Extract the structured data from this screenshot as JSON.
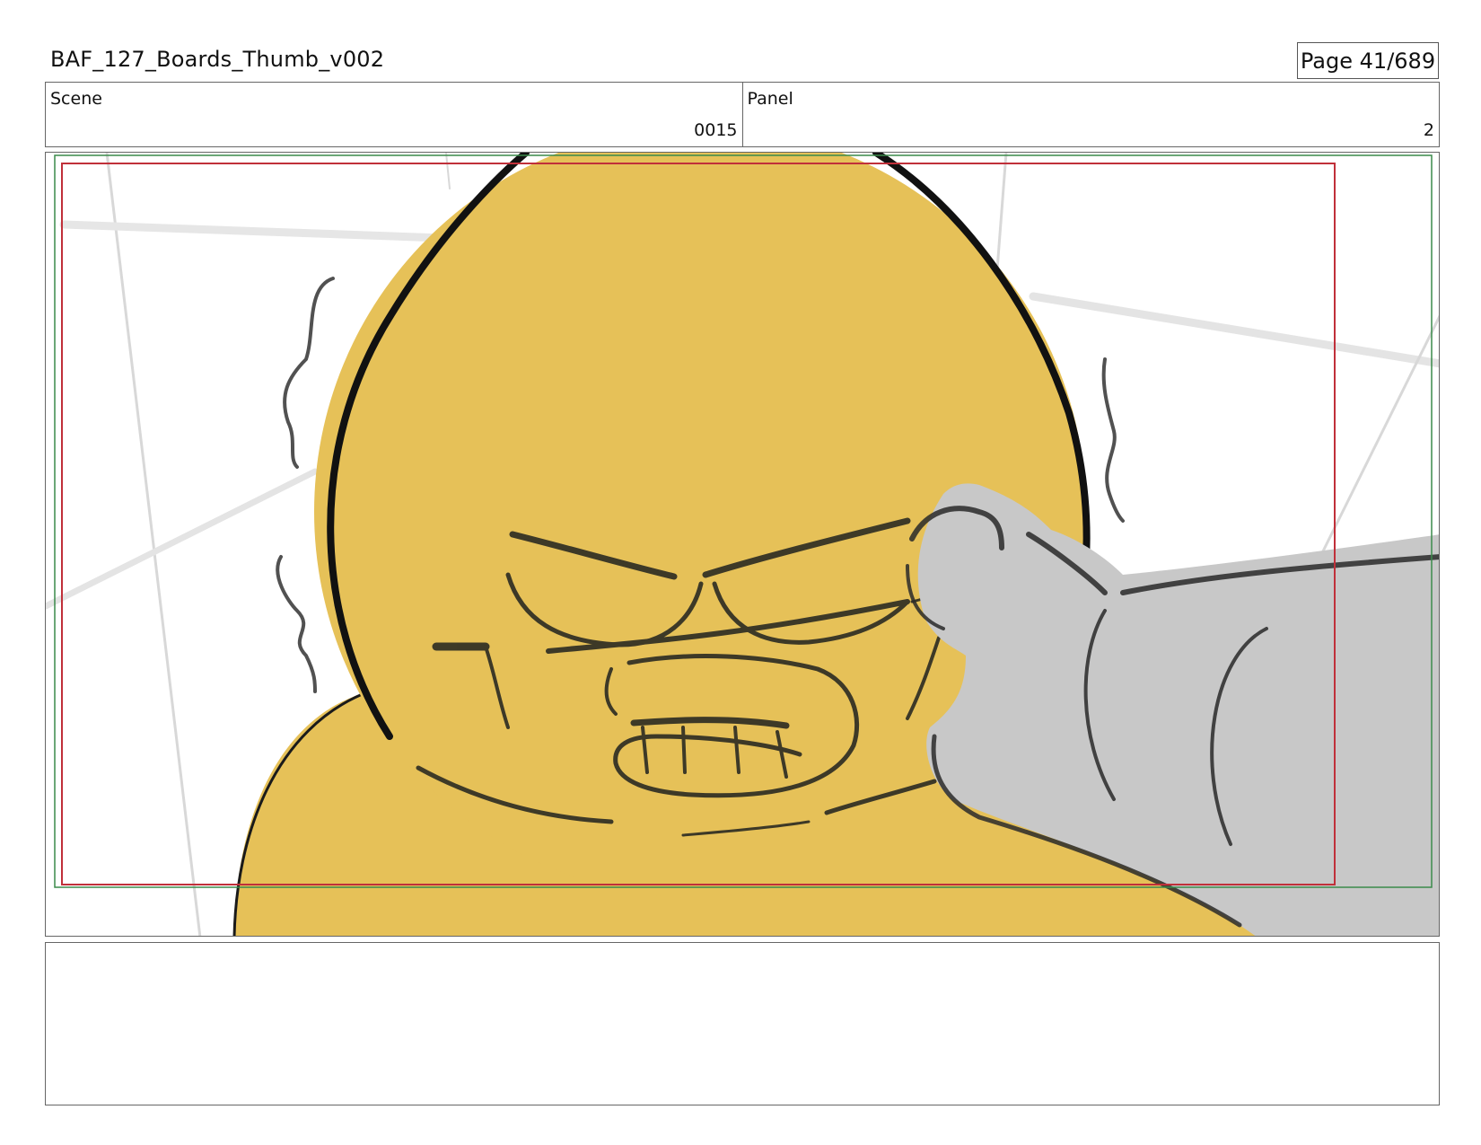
{
  "header": {
    "title": "BAF_127_Boards_Thumb_v002",
    "page_label": "Page",
    "page_number": "41/689"
  },
  "info": {
    "scene_label": "Scene",
    "scene_value": "0015",
    "panel_label": "Panel",
    "panel_value": "2"
  },
  "panel_image": {
    "description_icon": "storyboard-drawing",
    "colors": {
      "skin": "#E6C158",
      "glove": "#C8C8C8",
      "safe_area_red": "#C0303A",
      "safe_area_green": "#3A8A4A"
    }
  },
  "notes": {
    "text": ""
  }
}
